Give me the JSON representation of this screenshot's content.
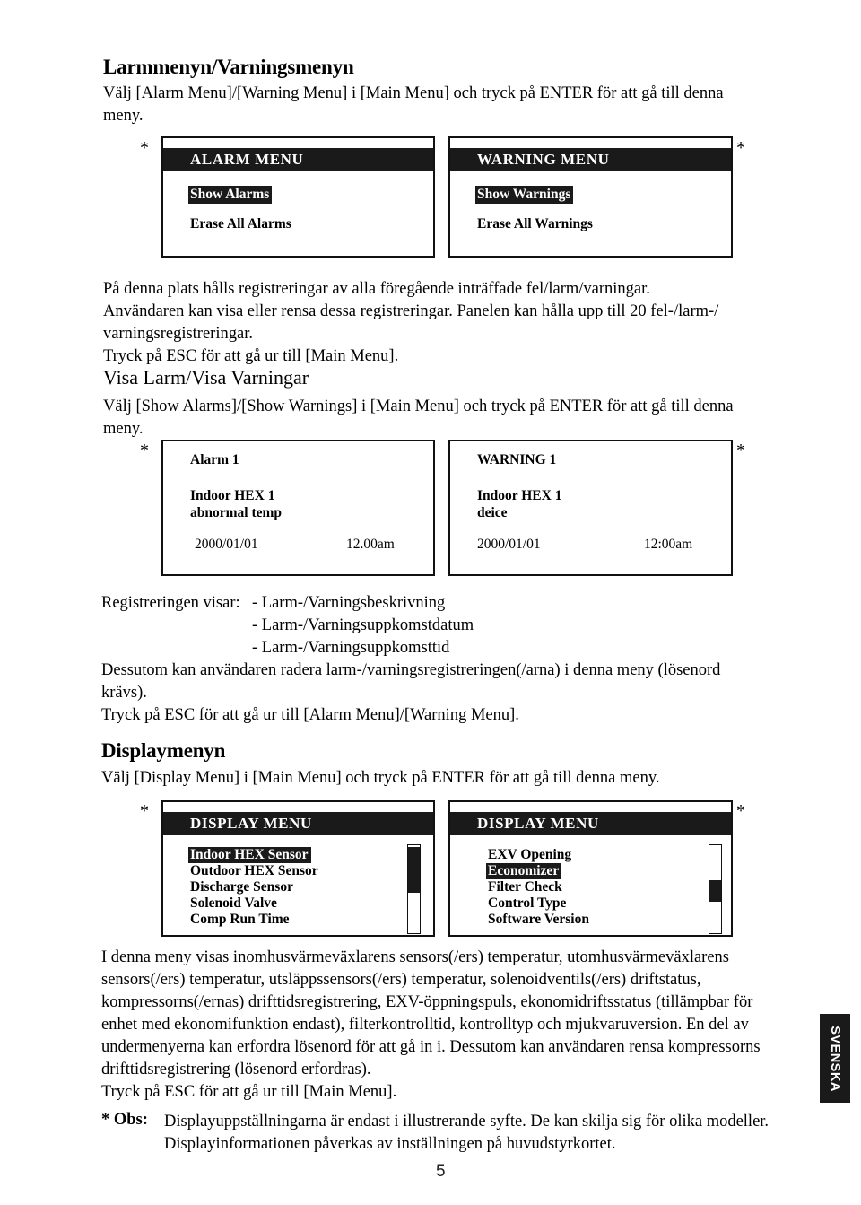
{
  "page": {
    "number": "5",
    "side_tab": "SVENSKA"
  },
  "section_alarm": {
    "heading": "Larmmenyn/Varningsmenyn",
    "intro_line1": "Välj [Alarm Menu]/[Warning Menu] i [Main Menu] och tryck på ENTER för att gå till denna",
    "intro_line2": "meny.",
    "asterisk": "*",
    "panel_left": {
      "title": "ALARM MENU",
      "items": [
        {
          "label": "Show Alarms",
          "selected": true
        },
        {
          "label": "Erase All Alarms",
          "selected": false
        }
      ]
    },
    "panel_right": {
      "title": "WARNING MENU",
      "items": [
        {
          "label": "Show Warnings",
          "selected": true
        },
        {
          "label": "Erase All Warnings",
          "selected": false
        }
      ]
    },
    "body_line1": "På denna plats hålls registreringar av alla föregående inträffade fel/larm/varningar.",
    "body_line2": "Användaren kan visa eller rensa dessa registreringar. Panelen kan hålla upp till 20 fel-/larm-/",
    "body_line3": "varningsregistreringar.",
    "body_line4": "Tryck på ESC för att gå ur till [Main Menu]."
  },
  "section_show": {
    "heading": "Visa Larm/Visa Varningar",
    "intro_line1": "Välj [Show Alarms]/[Show Warnings] i [Main Menu] och tryck på ENTER för att gå till denna",
    "intro_line2": "meny.",
    "asterisk": "*",
    "panel_left": {
      "title": "Alarm 1",
      "desc_line1": "Indoor HEX 1",
      "desc_line2": "abnormal temp",
      "date": "2000/01/01",
      "time": "12.00am"
    },
    "panel_right": {
      "title": "WARNING 1",
      "desc_line1": "Indoor HEX 1",
      "desc_line2": "deice",
      "date": "2000/01/01",
      "time": "12:00am"
    },
    "record_label": "Registreringen visar:",
    "record_items": [
      "- Larm-/Varningsbeskrivning",
      "- Larm-/Varningsuppkomstdatum",
      "- Larm-/Varningsuppkomsttid"
    ],
    "body_line1": "Dessutom kan användaren radera larm-/varningsregistreringen(/arna) i denna meny (lösenord",
    "body_line2": "krävs).",
    "body_line3": "Tryck på ESC för att gå ur till [Alarm Menu]/[Warning Menu]."
  },
  "section_display": {
    "heading": "Displaymenyn",
    "intro_line1": "Välj [Display Menu] i [Main Menu] och tryck på ENTER för att gå till denna meny.",
    "asterisk": "*",
    "panel_left": {
      "title": "DISPLAY MENU",
      "items": [
        {
          "label": "Indoor HEX Sensor",
          "selected": true
        },
        {
          "label": "Outdoor HEX Sensor",
          "selected": false
        },
        {
          "label": "Discharge Sensor",
          "selected": false
        },
        {
          "label": "Solenoid Valve",
          "selected": false
        },
        {
          "label": "Comp Run Time",
          "selected": false
        }
      ],
      "scrollbar_thumb_top_pct": 2,
      "scrollbar_thumb_height_pct": 52
    },
    "panel_right": {
      "title": "DISPLAY MENU",
      "items": [
        {
          "label": "EXV Opening",
          "selected": false
        },
        {
          "label": "Economizer",
          "selected": true
        },
        {
          "label": "Filter Check",
          "selected": false
        },
        {
          "label": "Control Type",
          "selected": false
        },
        {
          "label": "Software Version",
          "selected": false
        }
      ],
      "scrollbar_thumb_top_pct": 40,
      "scrollbar_thumb_height_pct": 24
    },
    "body_line1": "I denna meny visas inomhusvärmeväxlarens sensors(/ers) temperatur, utomhusvärmeväxlarens",
    "body_line2": "sensors(/ers) temperatur, utsläppssensors(/ers) temperatur, solenoidventils(/ers) driftstatus,",
    "body_line3": "kompressorns(/ernas) drifttidsregistrering, EXV-öppningspuls, ekonomidriftsstatus (tillämpbar för",
    "body_line4": "enhet med ekonomifunktion endast), filterkontrolltid, kontrolltyp och mjukvaruversion. En del av",
    "body_line5": "undermenyerna kan erfordra lösenord för att gå in i. Dessutom kan användaren rensa kompressorns",
    "body_line6": "drifttidsregistrering (lösenord erfordras).",
    "body_line7": "Tryck på ESC för att gå ur till [Main Menu].",
    "note_label": "* Obs:",
    "note_line1": "Displayuppställningarna är endast i illustrerande syfte. De kan skilja sig för olika modeller.",
    "note_line2": "Displayinformationen påverkas av inställningen på huvudstyrkortet."
  },
  "colors": {
    "ink": "#000000",
    "panel_header": "#1a1a1a",
    "panel_bg": "#ffffff"
  }
}
